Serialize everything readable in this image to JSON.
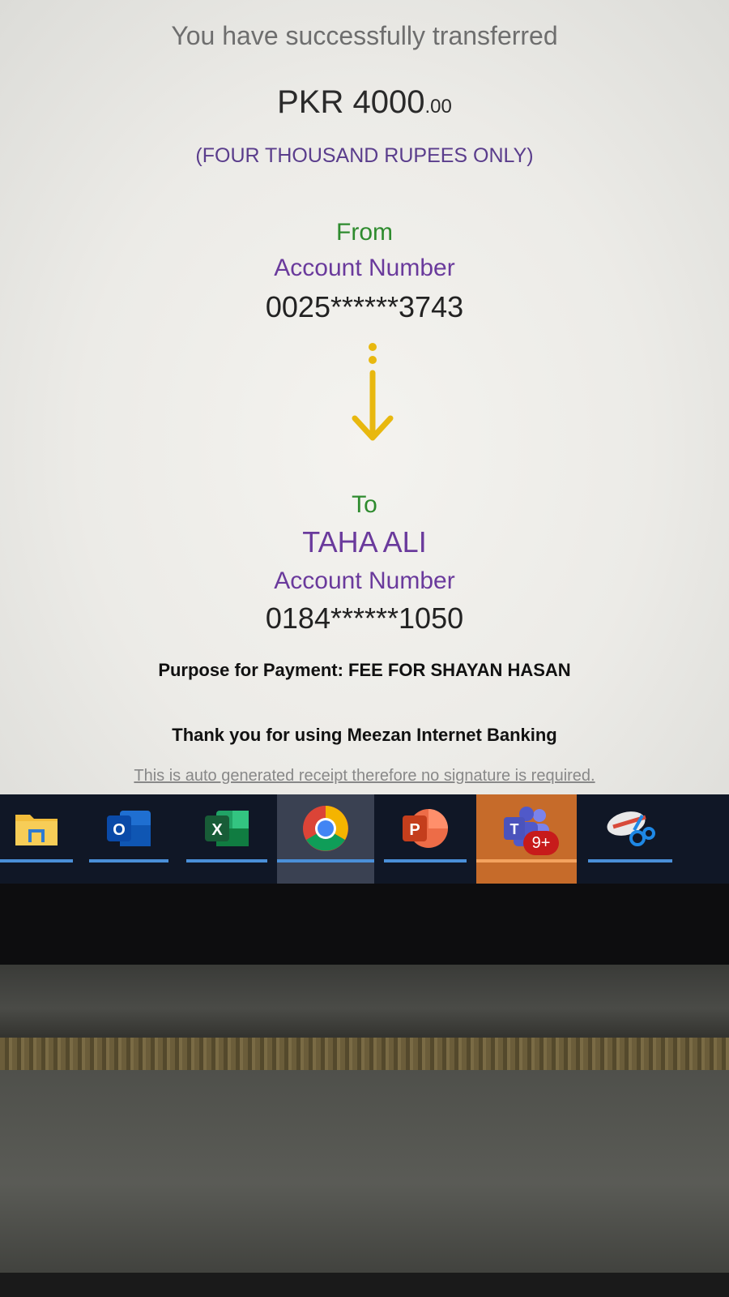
{
  "receipt": {
    "intro": "You have successfully transferred",
    "currency": "PKR",
    "amount_main": "4000",
    "amount_cents": ".00",
    "amount_words": "(FOUR THOUSAND RUPEES ONLY)",
    "from_label": "From",
    "from_account_label": "Account Number",
    "from_account_number": "0025******3743",
    "to_label": "To",
    "payee_name": "TAHA ALI",
    "to_account_label": "Account Number",
    "to_account_number": "0184******1050",
    "purpose": "Purpose for Payment: FEE FOR SHAYAN HASAN",
    "thanks": "Thank you for using Meezan Internet Banking",
    "footnote": "This is auto generated receipt therefore no signature is required."
  },
  "colors": {
    "green_label": "#2e8b2e",
    "purple_label": "#6a3a9c",
    "arrow": "#e8b80f",
    "taskbar": "#101726",
    "teams_active": "#c66b2a"
  },
  "taskbar": {
    "apps": [
      {
        "name": "File Explorer",
        "icon": "folder-icon"
      },
      {
        "name": "Outlook",
        "icon": "outlook-icon",
        "letter": "O"
      },
      {
        "name": "Excel",
        "icon": "excel-icon",
        "letter": "X"
      },
      {
        "name": "Chrome",
        "icon": "chrome-icon",
        "active": true
      },
      {
        "name": "PowerPoint",
        "icon": "powerpoint-icon",
        "letter": "P"
      },
      {
        "name": "Teams",
        "icon": "teams-icon",
        "letter": "T",
        "badge": "9+",
        "highlighted": true
      },
      {
        "name": "Snipping Tool",
        "icon": "snipping-tool-icon"
      }
    ]
  }
}
